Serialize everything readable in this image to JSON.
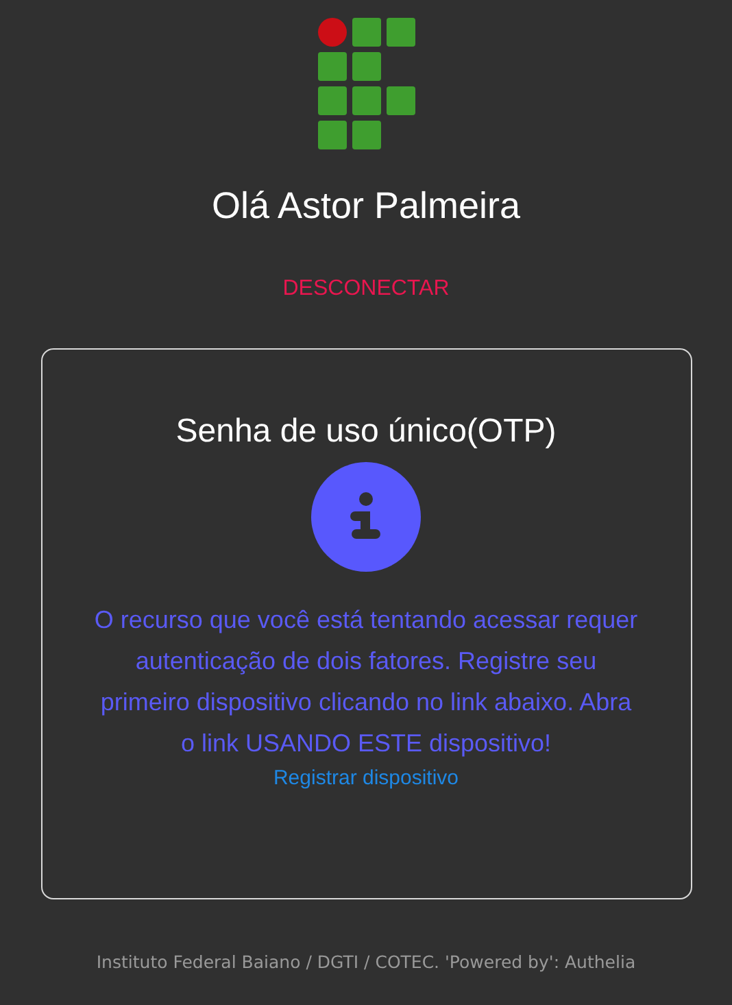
{
  "greeting": "Olá Astor Palmeira",
  "logout_link": "DESCONECTAR",
  "card": {
    "title": "Senha de uso único(OTP)",
    "message": "O recurso que você está tentando acessar requer autenticação de dois fatores. Registre seu primeiro dispositivo clicando no link abaixo. Abra o link USANDO ESTE dispositivo!",
    "link": "Registrar dispositivo"
  },
  "footer": "Instituto Federal Baiano / DGTI / COTEC. 'Powered by': Authelia"
}
